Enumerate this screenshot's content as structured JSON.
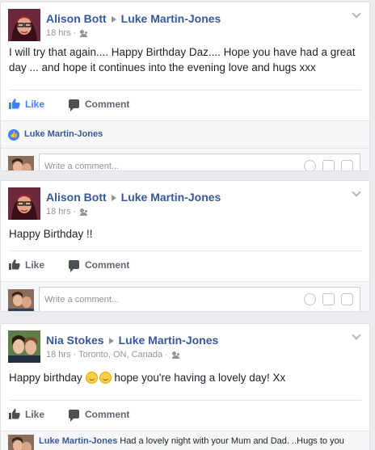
{
  "posts": [
    {
      "author": "Alison Bott",
      "target": "Luke Martin-Jones",
      "time": "18 hrs",
      "location": "",
      "text": "I will try that again.... Happy Birthday Daz.... Hope you have had a great day ... and hope it continues into the evening love and hugs xxx",
      "liked": true,
      "likers": "Luke Martin-Jones",
      "comment_placeholder": "Write a comment..."
    },
    {
      "author": "Alison Bott",
      "target": "Luke Martin-Jones",
      "time": "18 hrs",
      "location": "",
      "text": "Happy Birthday !!",
      "liked": false,
      "comment_placeholder": "Write a comment..."
    },
    {
      "author": "Nia Stokes",
      "target": "Luke Martin-Jones",
      "time": "18 hrs",
      "location": "Toronto, ON, Canada",
      "text_before": "Happy birthday",
      "text_after": "hope you're having a lovely day! Xx",
      "liked": false,
      "reply": {
        "author": "Luke Martin-Jones",
        "text": "Had a lovely night with your Mum and Dad. ..Hugs to you xxx"
      }
    }
  ],
  "labels": {
    "like": "Like",
    "comment": "Comment",
    "separator": " · "
  },
  "icons": [
    "friends-icon",
    "chevron-down-icon",
    "like-icon",
    "comment-icon",
    "smile-icon",
    "camera-icon",
    "sticker-icon",
    "smiley-emoji"
  ],
  "colors": {
    "link": "#365899",
    "like_active": "#4080ff",
    "background": "#e9ebee",
    "meta": "#90949c"
  }
}
